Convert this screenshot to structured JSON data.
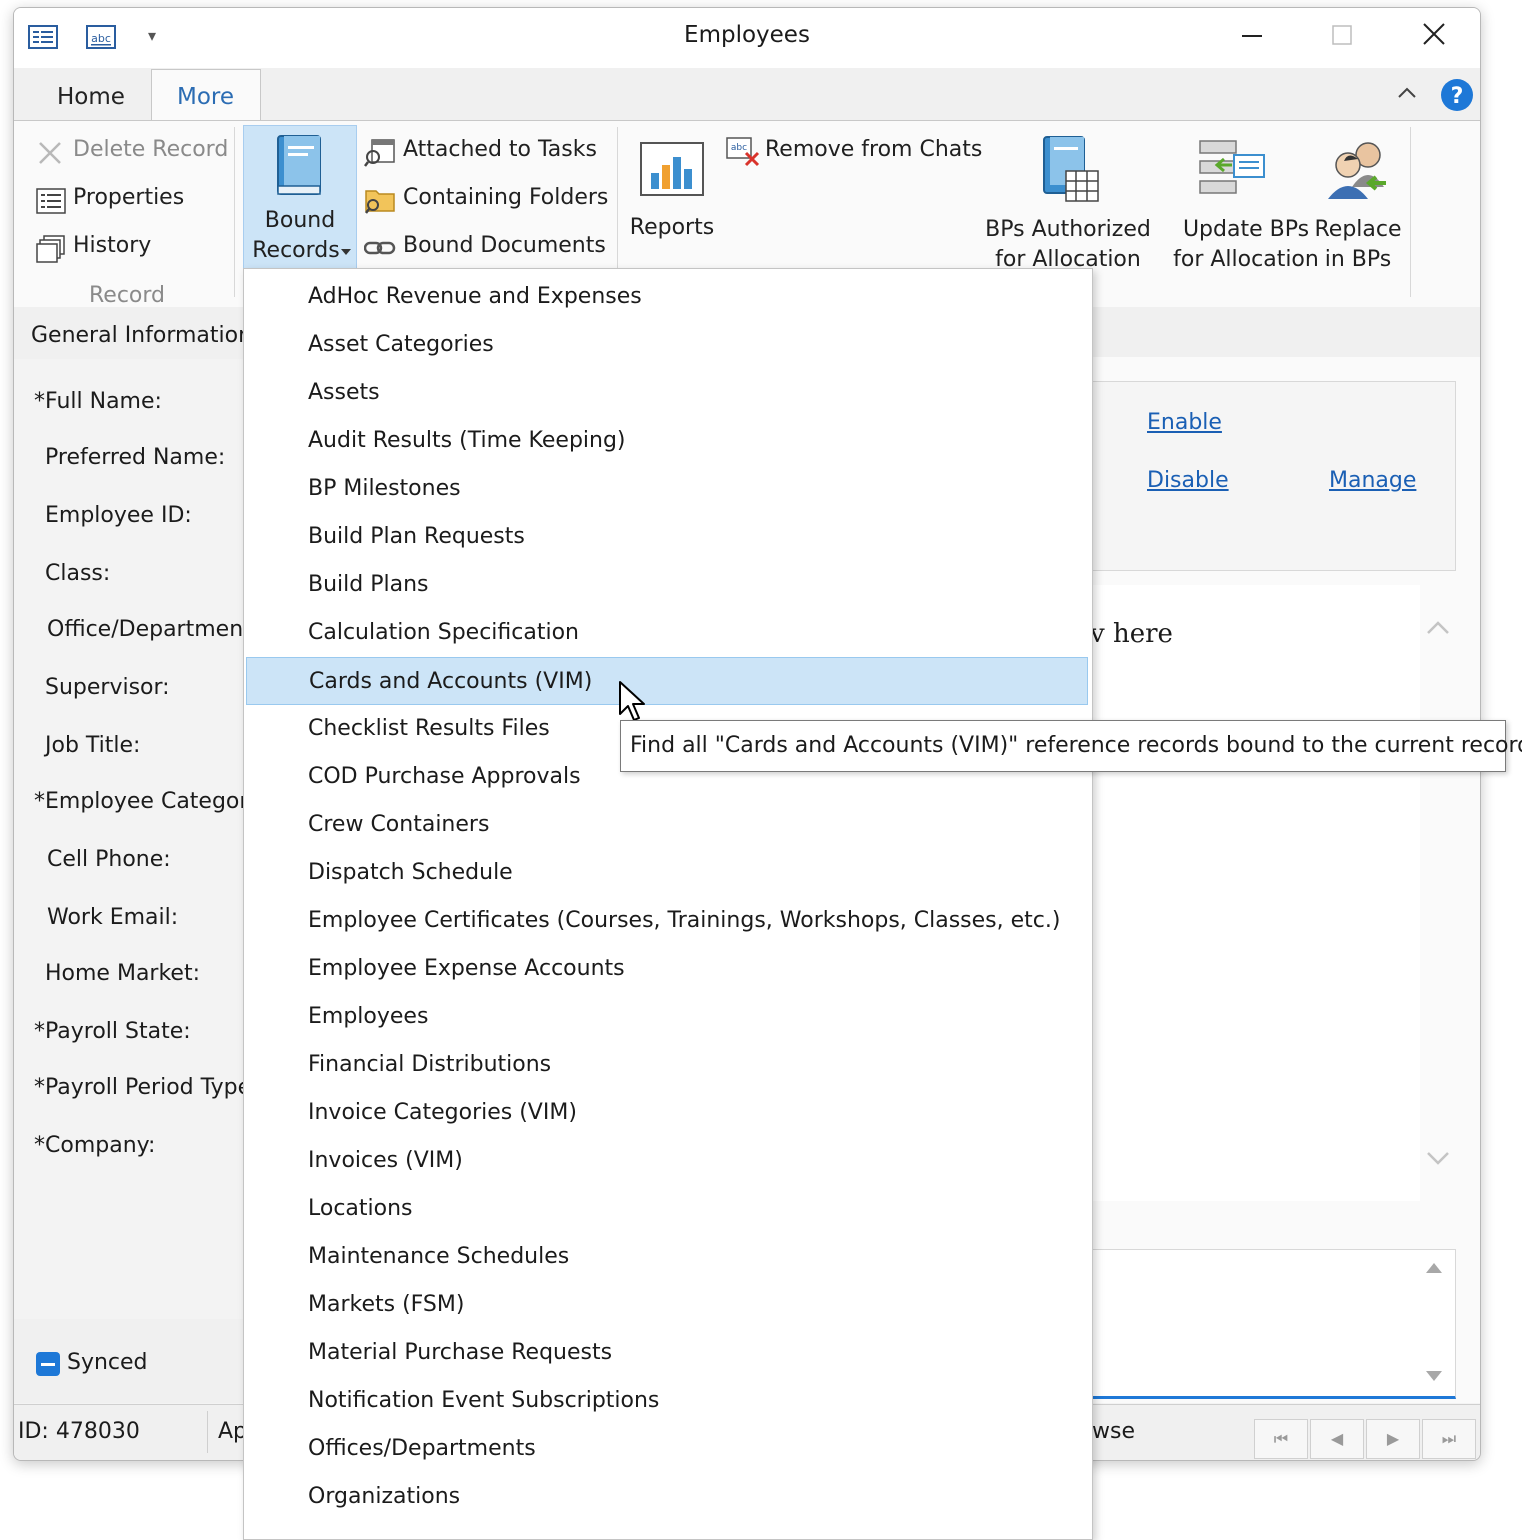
{
  "window": {
    "title": "Employees"
  },
  "tabs": [
    {
      "label": "Home"
    },
    {
      "label": "More"
    }
  ],
  "ribbon": {
    "record_group": {
      "delete_record": "Delete Record",
      "properties": "Properties",
      "history": "History",
      "group_label": "Record"
    },
    "bound_records": {
      "line1": "Bound",
      "line2": "Records"
    },
    "attached_to_tasks": "Attached to Tasks",
    "containing_folders": "Containing Folders",
    "bound_documents": "Bound Documents",
    "reports": "Reports",
    "remove_from_chats": "Remove from Chats",
    "bps_authorized": {
      "line1": "BPs Authorized",
      "line2": "for Allocation"
    },
    "update_bps": {
      "line1": "Update BPs",
      "line2": "for Allocation"
    },
    "replace_in_bps": {
      "line1": "Replace",
      "line2": "in BPs"
    }
  },
  "form": {
    "section_title": "General Information",
    "fields": [
      "*Full Name:",
      "Preferred Name:",
      "Employee ID:",
      "Class:",
      "Office/Department",
      "Supervisor:",
      "Job Title:",
      "*Employee Category",
      "Cell Phone:",
      "Work Email:",
      "Home Market:",
      "*Payroll State:",
      "*Payroll Period Type",
      "*Company:"
    ],
    "synced_label": "Synced"
  },
  "right_panel": {
    "enable_link": "Enable",
    "disable_link": "Disable",
    "manage_link": "Manage",
    "partial_text": "v here"
  },
  "status": {
    "id_text": "ID: 478030",
    "partial_left": "Ap",
    "partial_right": "wse"
  },
  "dropdown": {
    "items": [
      "AdHoc Revenue and Expenses",
      "Asset Categories",
      "Assets",
      "Audit Results (Time Keeping)",
      "BP Milestones",
      "Build Plan Requests",
      "Build Plans",
      "Calculation Specification",
      "Cards and Accounts (VIM)",
      "Checklist Results Files",
      "COD Purchase Approvals",
      "Crew Containers",
      "Dispatch Schedule",
      "Employee Certificates (Courses, Trainings, Workshops, Classes, etc.)",
      "Employee Expense Accounts",
      "Employees",
      "Financial Distributions",
      "Invoice Categories (VIM)",
      "Invoices (VIM)",
      "Locations",
      "Maintenance Schedules",
      "Markets (FSM)",
      "Material Purchase Requests",
      "Notification Event Subscriptions",
      "Offices/Departments",
      "Organizations"
    ],
    "highlighted_index": 8
  },
  "tooltip": {
    "text": "Find all \"Cards and Accounts (VIM)\" reference records bound to the current record"
  },
  "colors": {
    "accent": "#1a5fb4",
    "highlight": "#cce4f7",
    "help": "#1e78d7"
  }
}
